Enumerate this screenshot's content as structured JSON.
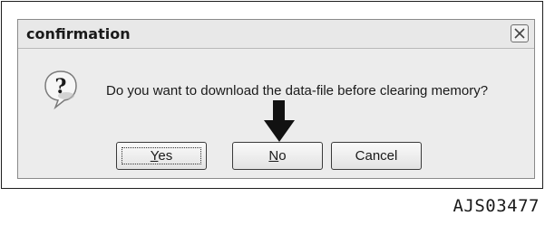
{
  "dialog": {
    "title": "confirmation",
    "message": "Do you want to download the data-file before clearing memory?",
    "buttons": {
      "yes": {
        "mnemonic": "Y",
        "rest": "es"
      },
      "no": {
        "mnemonic": "N",
        "rest": "o"
      },
      "cancel": {
        "label": "Cancel"
      }
    },
    "focused_button": "yes",
    "icon": "question-icon"
  },
  "annotation": {
    "arrow_target": "no",
    "figure_id": "AJS03477"
  }
}
